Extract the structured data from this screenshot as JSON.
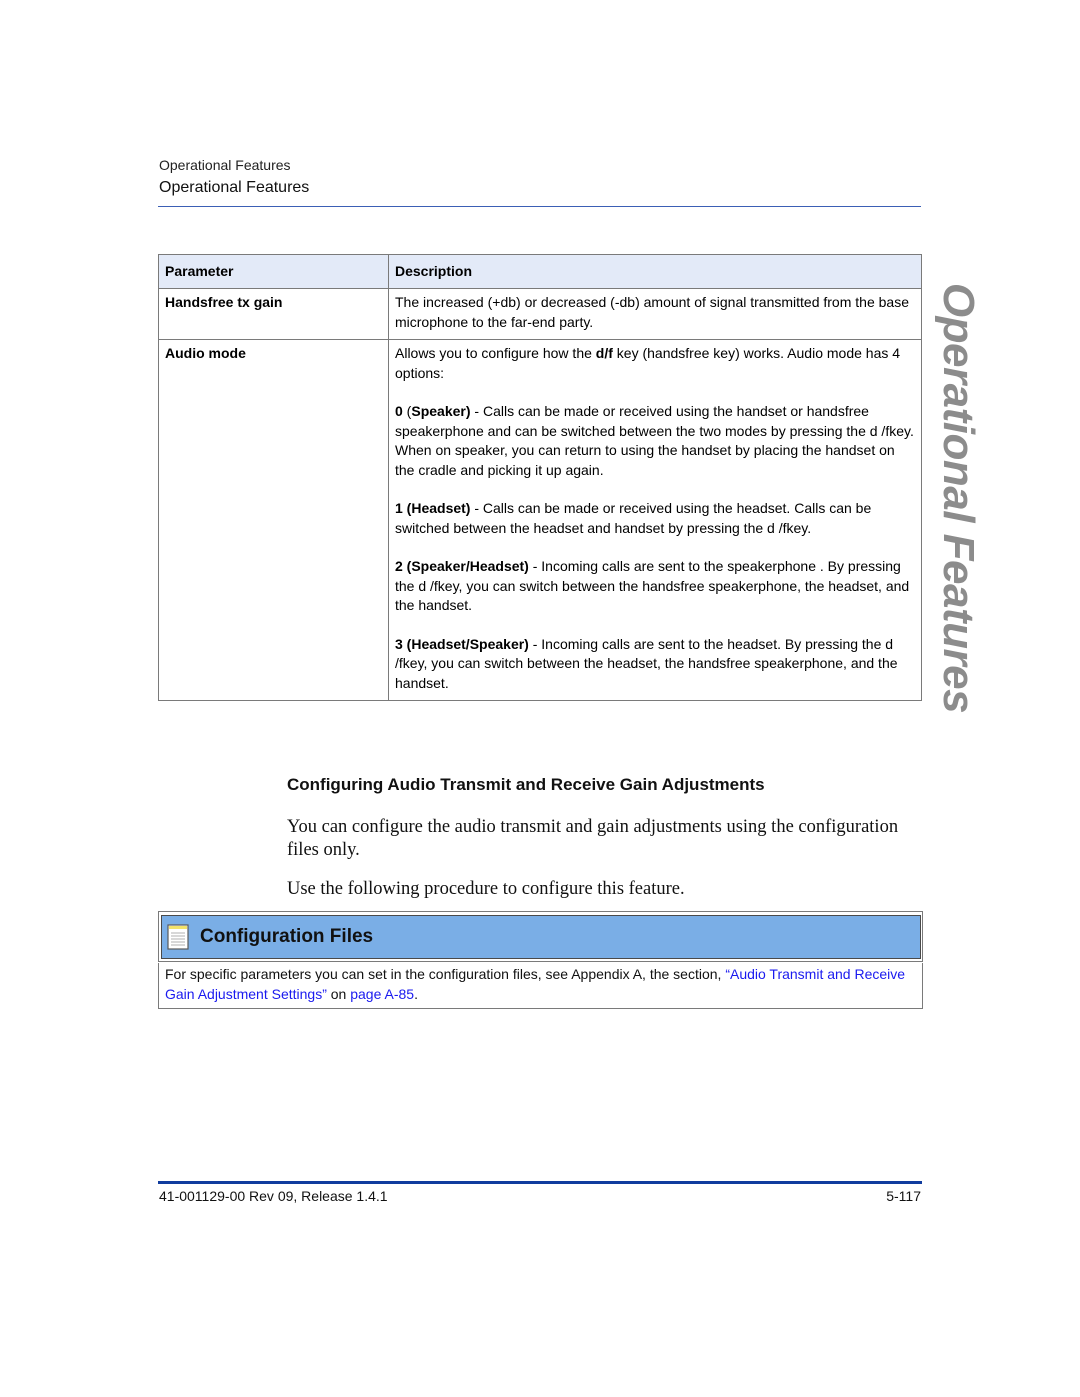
{
  "header": {
    "running_title_small": "Operational Features",
    "running_title": "Operational Features"
  },
  "side_tab": {
    "label": "Operational Features"
  },
  "table": {
    "headers": [
      "Parameter",
      "Description"
    ],
    "rows": [
      {
        "parameter": "Handsfree tx gain",
        "description": "The increased (+db) or decreased (-db) amount of signal transmitted from the base microphone to the far-end party."
      },
      {
        "parameter": "Audio mode",
        "intro_pre": "Allows you to configure how the ",
        "intro_key": "d/f",
        "intro_post": " key (handsfree key) works. Audio mode has 4 options:",
        "options": [
          {
            "num": "0",
            "label_open": " (",
            "label": "Speaker)",
            "text": " - Calls can be made or received using the handset or handsfree speakerphone and can be switched between the two modes by pressing the d /fkey. When on speaker, you can return to using the handset by placing the handset on the cradle and picking it up again."
          },
          {
            "num": "1 (Headset)",
            "label_open": "",
            "label": "",
            "text": " - Calls can be made or received using the headset. Calls can be switched between the headset and handset by pressing the d /fkey."
          },
          {
            "num": "2 (Speaker/Headset)",
            "label_open": "",
            "label": "",
            "text": " - Incoming calls are sent to the speakerphone . By pressing the d /fkey, you can switch between the handsfree speakerphone, the headset, and the handset."
          },
          {
            "num": "3 (Headset/Speaker)",
            "label_open": "",
            "label": "",
            "text": " - Incoming calls are sent to the headset. By pressing the d /fkey, you can switch between the headset, the handsfree speakerphone, and the handset."
          }
        ]
      }
    ]
  },
  "section": {
    "heading": "Configuring Audio Transmit and Receive Gain Adjustments",
    "para1": "You can configure the audio transmit and gain adjustments using the configuration files only.",
    "para2": "Use the following procedure to configure this feature."
  },
  "callout": {
    "title": "Configuration Files",
    "icon": "notepad-icon",
    "text_pre": "For specific parameters you can set in the configuration files, see Appendix A, the section, ",
    "link1": "“Audio Transmit and Receive Gain Adjustment Settings”",
    "text_mid": " on ",
    "link2": "page A-85",
    "text_post": "."
  },
  "footer": {
    "doc_id": "41-001129-00 Rev 09, Release 1.4.1",
    "page": "5-117"
  },
  "colors": {
    "header_rule": "#3b5fb5",
    "table_header_bg": "#e3eaf8",
    "callout_bg": "#7aaee6",
    "link": "#1a1aef",
    "footer_rule": "#103c9e",
    "side_tab": "#8c8c8c"
  }
}
